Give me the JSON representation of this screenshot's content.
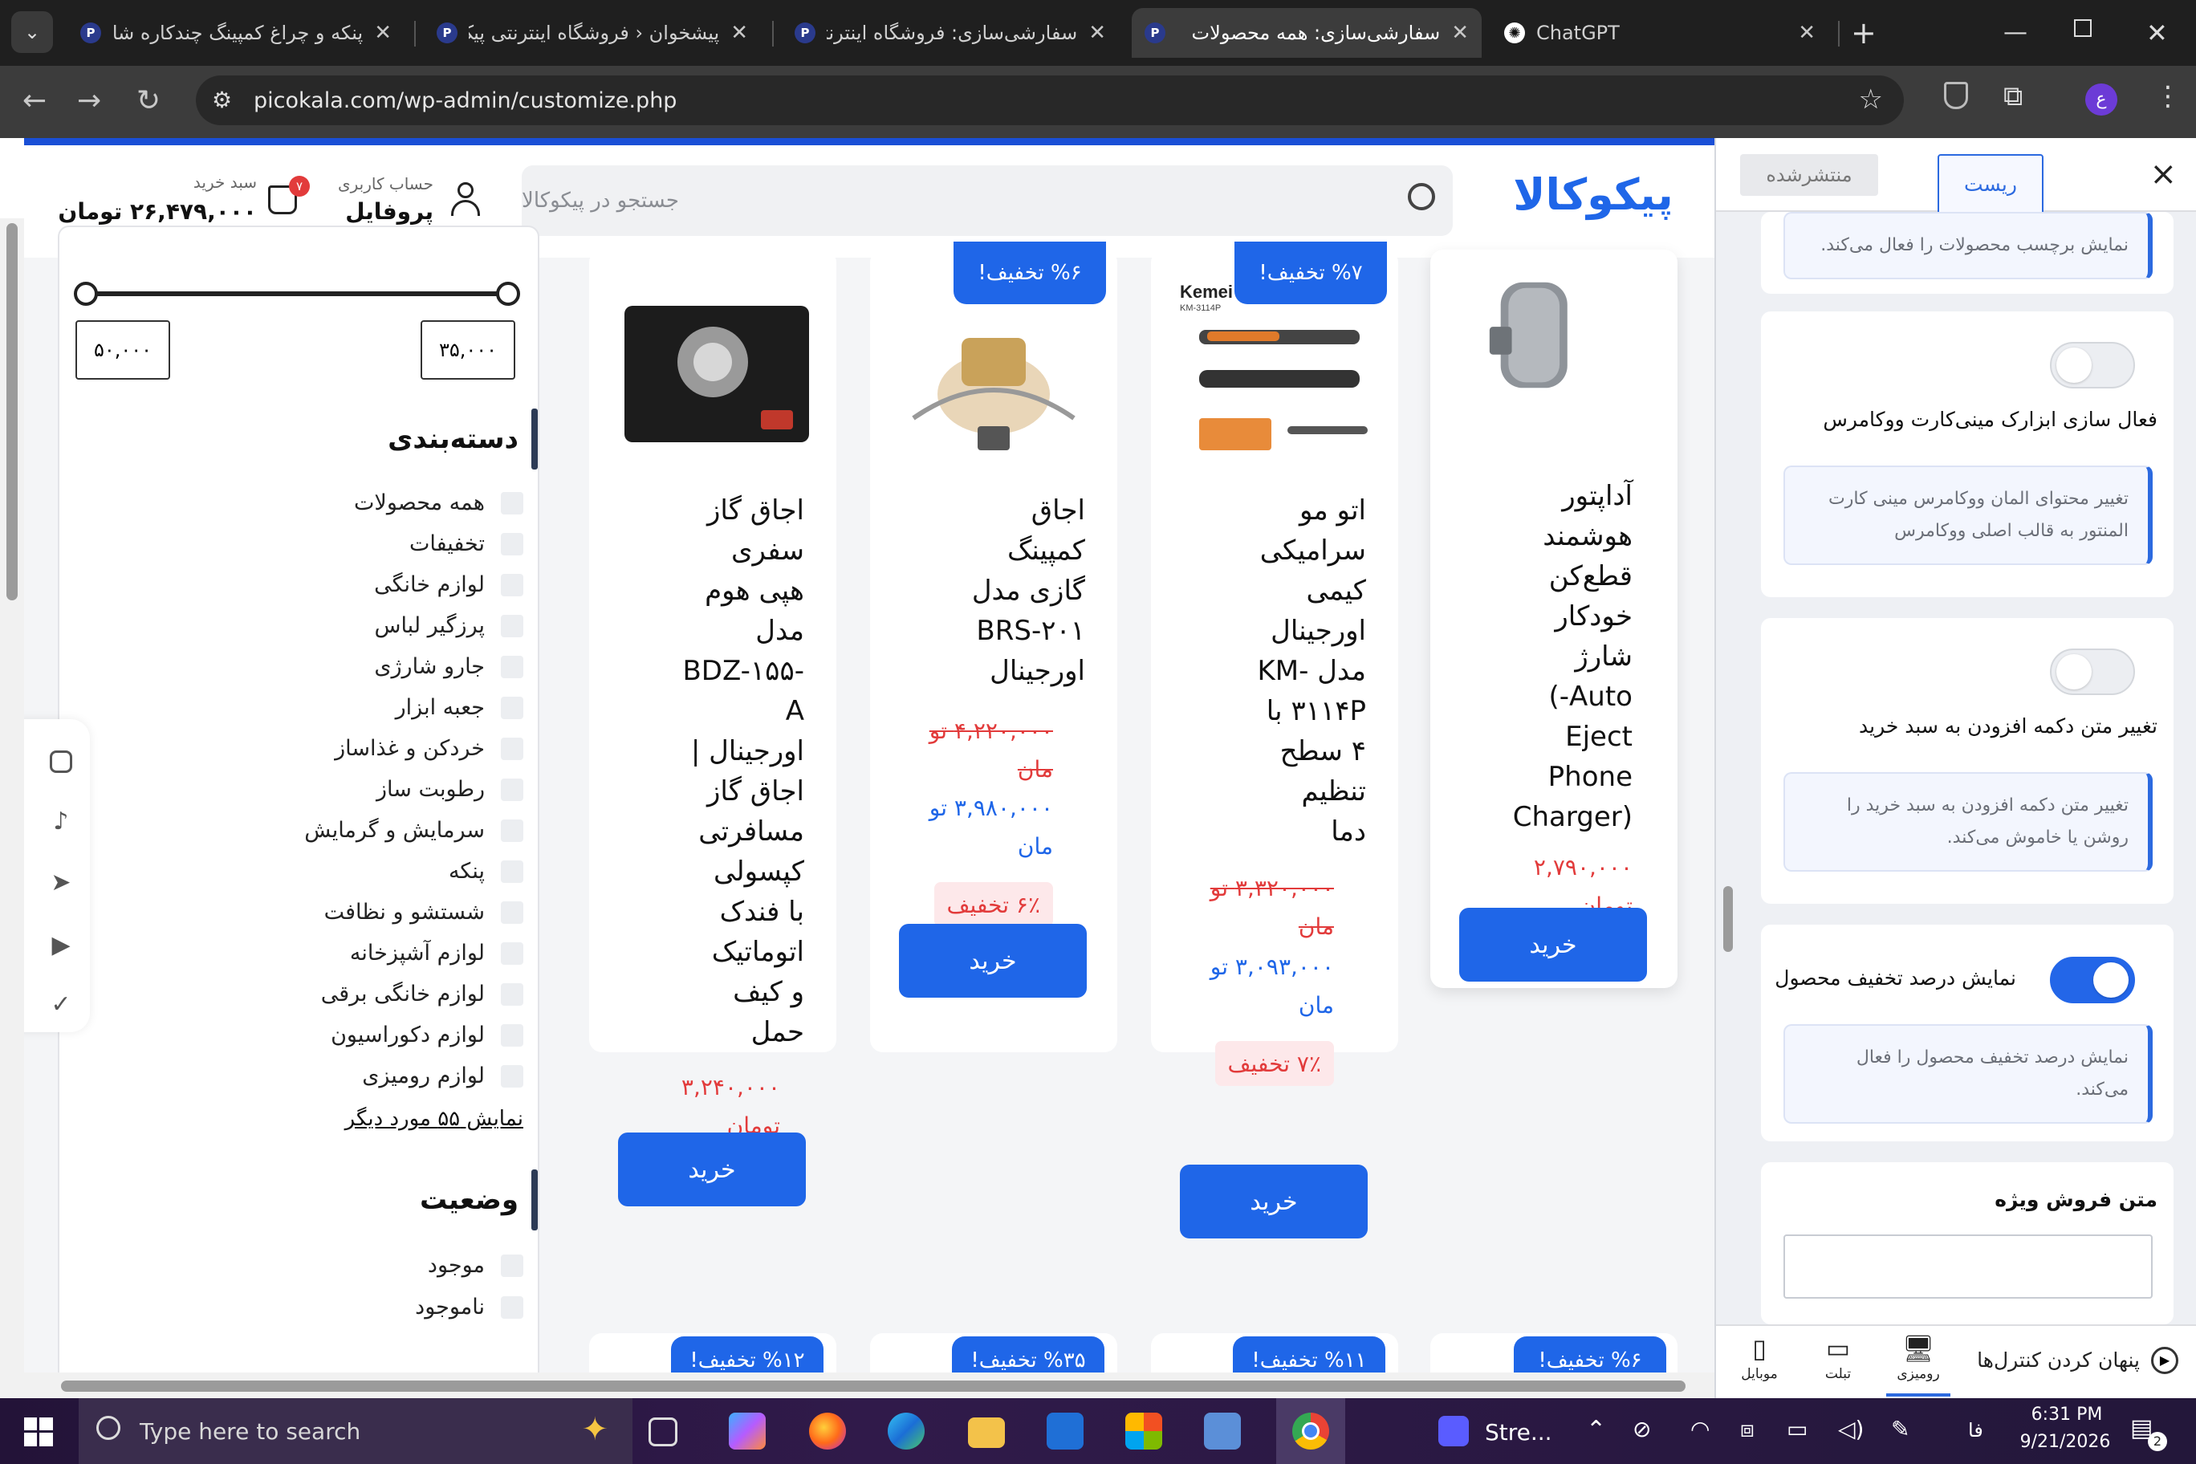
{
  "browser": {
    "tabs": [
      {
        "title": "پنکه و چراغ کمپینگ چندکاره شار",
        "active": false
      },
      {
        "title": "پیشخوان ‹ فروشگاه اینترنتی پیک",
        "active": false
      },
      {
        "title": "سفارشی‌سازی: فروشگاه اینترنتی",
        "active": false
      },
      {
        "title": "سفارشی‌سازی: همه محصولات",
        "active": true
      },
      {
        "title": "ChatGPT",
        "active": false
      }
    ],
    "url": "picokala.com/wp-admin/customize.php",
    "profile_letter": "ع"
  },
  "site": {
    "logo": "پیکوکالا",
    "search_placeholder": "جستجو در پیکوکالا",
    "account_label": "حساب کاربری",
    "account_name": "پروفایل",
    "cart_label": "سبد خرید",
    "cart_total": "۲۶,۴۷۹,۰۰۰ تومان",
    "cart_count": "۷"
  },
  "filter": {
    "price_min": "۳۵,۰۰۰",
    "price_max": "۵۰,۰۰۰",
    "category_title": "دسته‌بندی",
    "categories": [
      "همه محصولات",
      "تخفیفات",
      "لوازم خانگی",
      "پرزگیر لباس",
      "جارو شارژی",
      "جعبه ابزار",
      "خردکن و غذاساز",
      "رطوبت ساز",
      "سرمایش و گرمایش",
      "پنکه",
      "شستشو و نظافت",
      "لوازم آشپزخانه",
      "لوازم خانگی برقی",
      "لوازم دکوراسیون",
      "لوازم رومیزی"
    ],
    "show_more": "نمایش ۵۵ مورد دیگر",
    "status_title": "وضعیت",
    "statuses": [
      "موجود",
      "ناموجود"
    ]
  },
  "products": [
    {
      "name": "آداپتور هوشمند قطع‌کن خودکار شارژ (Auto-Eject Phone Charger)",
      "lines": [
        "آداپتور",
        "هوشمند",
        "قطع‌کن",
        "خودکار",
        "شارژ",
        "Auto-)",
        "Eject",
        "Phone",
        "(Charger"
      ],
      "price_lines": [
        "۲,۷۹۰,۰۰۰",
        "تومان"
      ],
      "badge": "",
      "buy": "خرید"
    },
    {
      "name": "اتو مو سرامیکی کیمی اورجینال مدل KM-۳۱۱۴P با ۴ سطح تنظیم دما",
      "lines": [
        "اتو مو",
        "سرامیکی",
        "کیمی",
        "اورجینال",
        "مدل -KM",
        "۳۱۱۴P با",
        "۴ سطح",
        "تنظیم",
        "دما"
      ],
      "old_lines": [
        "۳,۳۲۰,۰۰۰ تو",
        "مان"
      ],
      "new_lines": [
        "۳,۰۹۳,۰۰۰ تو",
        "مان"
      ],
      "discount": "۷٪ تخفیف",
      "badge": "%۷ تخفیف!",
      "image_text": "Kemei",
      "image_model": "KM-3114P",
      "buy": "خرید"
    },
    {
      "name": "اجاق کمپینگ گازی مدل BRS-۲۰۱ اورجینال",
      "lines": [
        "اجاق",
        "کمپینگ",
        "گازی مدل",
        "BRS-۲۰۱",
        "اورجینال"
      ],
      "old_lines": [
        "۴,۲۲۰,۰۰۰ تو",
        "مان"
      ],
      "new_lines": [
        "۳,۹۸۰,۰۰۰ تو",
        "مان"
      ],
      "discount": "۶٪ تخفیف",
      "badge": "%۶ تخفیف!",
      "buy": "خرید"
    },
    {
      "name": "اجاق گاز سفری هپی هوم مدل BDZ-۱۵۵-A اورجینال | اجاق گاز مسافرتی کپسولی با فندک اتوماتیک و کیف حمل",
      "lines": [
        "اجاق گاز",
        "سفری",
        "هپی هوم",
        "مدل",
        "-BDZ-۱۵۵",
        "A",
        "اورجینال |",
        "اجاق گاز",
        "مسافرتی",
        "کپسولی",
        "با فندک",
        "اتوماتیک",
        "و کیف",
        "حمل"
      ],
      "price_lines": [
        "۳,۲۴۰,۰۰۰",
        "تومان"
      ],
      "badge": "",
      "buy": "خرید"
    }
  ],
  "second_row_badges": [
    "%۶ تخفیف!",
    "%۱۱ تخفیف!",
    "%۳۵ تخفیف!",
    "%۱۲ تخفیف!"
  ],
  "panel": {
    "close": "×",
    "publish": "منتشرشده",
    "reset": "ریست",
    "top_note": "نمایش برچسب محصولات را فعال می‌کند.",
    "settings": [
      {
        "label": "فعال سازی ابزارک مینی‌کارت ووکامرس",
        "note": "تغییر محتوای المان ووکامرس مینی کارت المنتور به قالب اصلی ووکامرس",
        "on": false
      },
      {
        "label": "تغییر متن دکمه افزودن به سبد خرید",
        "note": "تغییر متن دکمه افزودن به سبد خرید را روشن یا خاموش می‌کند.",
        "on": false
      },
      {
        "label": "نمایش درصد تخفیف محصول",
        "note": "نمایش درصد تخفیف محصول را فعال می‌کند.",
        "on": true
      }
    ],
    "special_sale_label": "متن فروش ویژه",
    "hide_controls": "پنهان کردن کنترل‌ها",
    "devices": [
      "رومیزی",
      "تبلت",
      "موبایل"
    ]
  },
  "taskbar": {
    "search_placeholder": "Type here to search",
    "stream_label": "Stre...",
    "lang": "فا",
    "time": "6:31 PM",
    "date": "9/21/2026",
    "notif_count": "2"
  },
  "colors": {
    "brand_blue": "#1f66e8",
    "discount_red": "#e23b3b",
    "dark_chrome": "#1f1f1f"
  }
}
